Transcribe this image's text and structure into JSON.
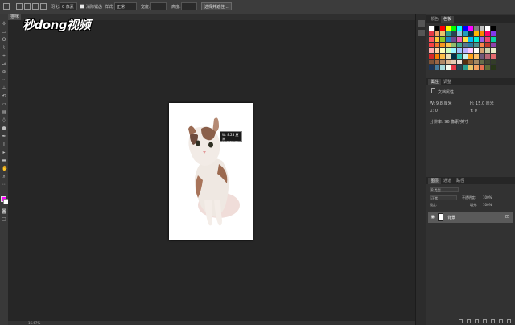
{
  "logo": {
    "text": "秒dong视频"
  },
  "options_bar": {
    "feather_label": "羽化:",
    "feather_value": "0 像素",
    "antialias_label": "消除锯齿",
    "style_label": "样式:",
    "style_value": "正常",
    "width_label": "宽度:",
    "height_label": "高度:",
    "select_mask_button": "选择并遮住..."
  },
  "document": {
    "tab_label": "猫咪",
    "zoom": "16.67%",
    "hud_width": "W: 8.28 厘米",
    "hud_height": "H: 8.28 厘米"
  },
  "panels": {
    "swatches_tabs": [
      "颜色",
      "色板"
    ],
    "properties_tabs": [
      "属性",
      "调整"
    ],
    "properties": {
      "type_label": "文档属性",
      "w_label": "W: 9.8 厘米",
      "h_label": "H: 15.0 厘米",
      "x_label": "X: 0",
      "y_label": "Y: 0",
      "resolution_label": "分辨率: 96 像素/英寸"
    },
    "layers_tabs": [
      "图层",
      "通道",
      "路径"
    ],
    "layers": {
      "kind_label": "P 类型",
      "blend_mode": "正常",
      "opacity_label": "不透明度:",
      "opacity_value": "100%",
      "lock_label": "锁定:",
      "fill_label": "填充:",
      "fill_value": "100%",
      "layer_name": "背景"
    }
  },
  "swatch_colors": [
    [
      "#ffffff",
      "#000000",
      "#ff0000",
      "#ffff00",
      "#00ff00",
      "#00ffff",
      "#0000ff",
      "#ff00ff",
      "#808080",
      "#c0c0c0",
      "#ffffff",
      "#000000"
    ],
    [
      "#e63946",
      "#f4a261",
      "#e9c46a",
      "#2a9d8f",
      "#264653",
      "#8ecae6",
      "#219ebc",
      "#023047",
      "#ffb703",
      "#fb8500",
      "#ff006e",
      "#8338ec"
    ],
    [
      "#ff595e",
      "#ffca3a",
      "#8ac926",
      "#1982c4",
      "#6a4c93",
      "#f15bb5",
      "#fee440",
      "#00bbf9",
      "#00f5d4",
      "#9b5de5",
      "#ef476f",
      "#06d6a0"
    ],
    [
      "#f94144",
      "#f3722c",
      "#f8961e",
      "#f9c74f",
      "#90be6d",
      "#43aa8b",
      "#577590",
      "#277da1",
      "#4d908e",
      "#f9844a",
      "#c0392b",
      "#8e44ad"
    ],
    [
      "#ffadad",
      "#ffd6a5",
      "#fdffb6",
      "#caffbf",
      "#9bf6ff",
      "#a0c4ff",
      "#bdb2ff",
      "#ffc6ff",
      "#fffffc",
      "#d4a373",
      "#ccd5ae",
      "#e9edc9"
    ],
    [
      "#d62828",
      "#f77f00",
      "#fcbf49",
      "#eae2b7",
      "#003049",
      "#2ec4b6",
      "#cbf3f0",
      "#ff9f1c",
      "#ffbf69",
      "#6d597a",
      "#b56576",
      "#e56b6f"
    ],
    [
      "#7f5539",
      "#9c6644",
      "#b08968",
      "#ddb892",
      "#e6ccb2",
      "#ede0d4",
      "#582f0e",
      "#936639",
      "#a68a64",
      "#656d4a",
      "#414833",
      "#333d29"
    ],
    [
      "#1d3557",
      "#457b9d",
      "#a8dadc",
      "#f1faee",
      "#e63946",
      "#264653",
      "#2a9d8f",
      "#e9c46a",
      "#f4a261",
      "#e76f51",
      "#606c38",
      "#283618"
    ]
  ]
}
